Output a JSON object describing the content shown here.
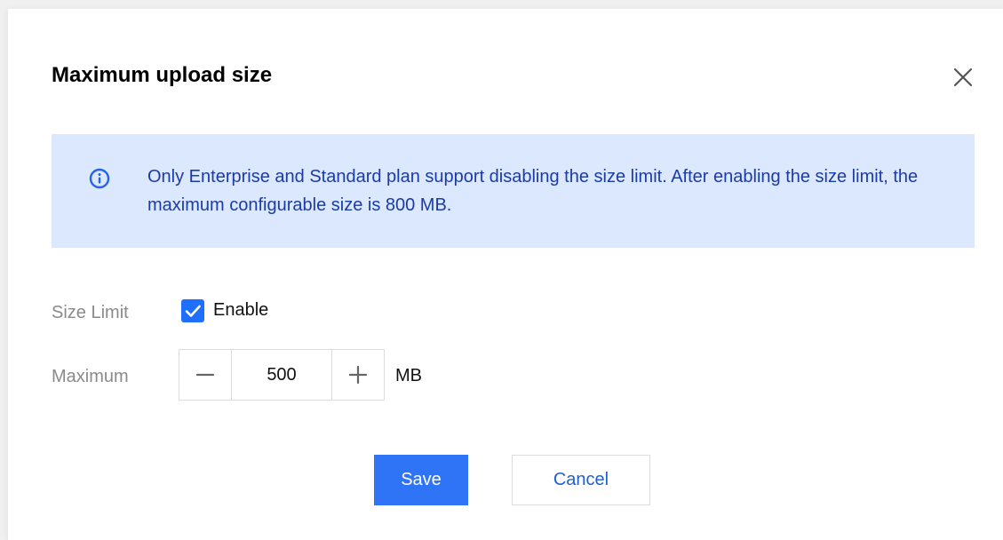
{
  "dialog": {
    "title": "Maximum upload size",
    "close_icon": "close-icon"
  },
  "notice": {
    "icon": "info-icon",
    "text": "Only Enterprise and Standard plan support disabling the size limit. After enabling the size limit, the maximum configurable size is 800 MB."
  },
  "size_limit": {
    "label": "Size Limit",
    "checkbox_label": "Enable",
    "checked": true
  },
  "maximum": {
    "label": "Maximum",
    "value": "500",
    "unit": "MB",
    "decrement_icon": "minus-icon",
    "increment_icon": "plus-icon"
  },
  "footer": {
    "save_label": "Save",
    "cancel_label": "Cancel"
  },
  "colors": {
    "primary": "#2f74f6",
    "notice_background": "#dbe8fe",
    "notice_text": "#1b3ba7"
  }
}
